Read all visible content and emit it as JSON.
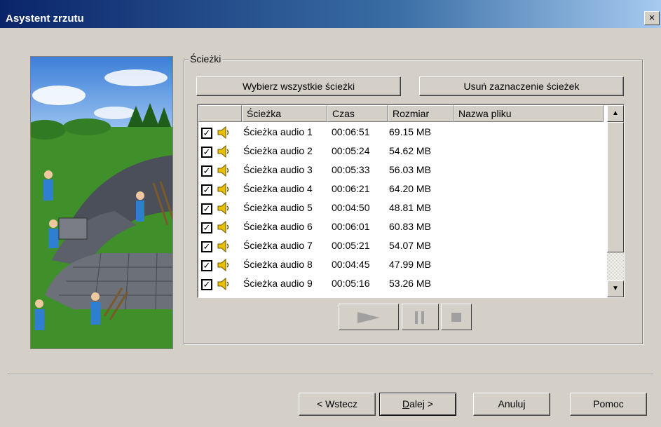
{
  "window": {
    "title": "Asystent zrzutu",
    "close_label": "×"
  },
  "tracks_group": {
    "legend": "Ścieżki",
    "select_all_label": "Wybierz wszystkie ścieżki",
    "deselect_label": "Usuń zaznaczenie ścieżek",
    "columns": [
      "Ścieżka",
      "Czas",
      "Rozmiar",
      "Nazwa pliku"
    ],
    "tracks": [
      {
        "checked": true,
        "name": "Ścieżka audio 1",
        "time": "00:06:51",
        "size": "69.15 MB",
        "filename": ""
      },
      {
        "checked": true,
        "name": "Ścieżka audio 2",
        "time": "00:05:24",
        "size": "54.62 MB",
        "filename": ""
      },
      {
        "checked": true,
        "name": "Ścieżka audio 3",
        "time": "00:05:33",
        "size": "56.03 MB",
        "filename": ""
      },
      {
        "checked": true,
        "name": "Ścieżka audio 4",
        "time": "00:06:21",
        "size": "64.20 MB",
        "filename": ""
      },
      {
        "checked": true,
        "name": "Ścieżka audio 5",
        "time": "00:04:50",
        "size": "48.81 MB",
        "filename": ""
      },
      {
        "checked": true,
        "name": "Ścieżka audio 6",
        "time": "00:06:01",
        "size": "60.83 MB",
        "filename": ""
      },
      {
        "checked": true,
        "name": "Ścieżka audio 7",
        "time": "00:05:21",
        "size": "54.07 MB",
        "filename": ""
      },
      {
        "checked": true,
        "name": "Ścieżka audio 8",
        "time": "00:04:45",
        "size": "47.99 MB",
        "filename": ""
      },
      {
        "checked": true,
        "name": "Ścieżka audio 9",
        "time": "00:05:16",
        "size": "53.26 MB",
        "filename": ""
      }
    ],
    "media_controls": [
      "play-icon",
      "pause-icon",
      "stop-icon"
    ]
  },
  "footer": {
    "back_label": "< Wstecz",
    "next_label": "Dalej >",
    "cancel_label": "Anuluj",
    "help_label": "Pomoc"
  },
  "colors": {
    "dialog_bg": "#d4d0c8",
    "titlebar_start": "#0a246a",
    "titlebar_end": "#a6caf0",
    "speaker": "#e8c000"
  }
}
